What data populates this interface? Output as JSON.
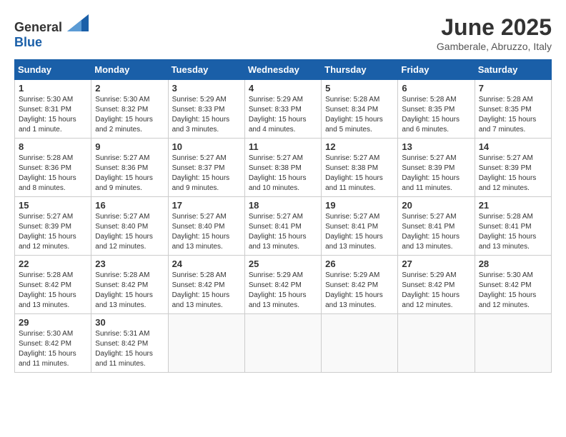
{
  "header": {
    "logo_general": "General",
    "logo_blue": "Blue",
    "title": "June 2025",
    "subtitle": "Gamberale, Abruzzo, Italy"
  },
  "columns": [
    "Sunday",
    "Monday",
    "Tuesday",
    "Wednesday",
    "Thursday",
    "Friday",
    "Saturday"
  ],
  "weeks": [
    [
      {
        "day": "1",
        "info": "Sunrise: 5:30 AM\nSunset: 8:31 PM\nDaylight: 15 hours\nand 1 minute."
      },
      {
        "day": "2",
        "info": "Sunrise: 5:30 AM\nSunset: 8:32 PM\nDaylight: 15 hours\nand 2 minutes."
      },
      {
        "day": "3",
        "info": "Sunrise: 5:29 AM\nSunset: 8:33 PM\nDaylight: 15 hours\nand 3 minutes."
      },
      {
        "day": "4",
        "info": "Sunrise: 5:29 AM\nSunset: 8:33 PM\nDaylight: 15 hours\nand 4 minutes."
      },
      {
        "day": "5",
        "info": "Sunrise: 5:28 AM\nSunset: 8:34 PM\nDaylight: 15 hours\nand 5 minutes."
      },
      {
        "day": "6",
        "info": "Sunrise: 5:28 AM\nSunset: 8:35 PM\nDaylight: 15 hours\nand 6 minutes."
      },
      {
        "day": "7",
        "info": "Sunrise: 5:28 AM\nSunset: 8:35 PM\nDaylight: 15 hours\nand 7 minutes."
      }
    ],
    [
      {
        "day": "8",
        "info": "Sunrise: 5:28 AM\nSunset: 8:36 PM\nDaylight: 15 hours\nand 8 minutes."
      },
      {
        "day": "9",
        "info": "Sunrise: 5:27 AM\nSunset: 8:36 PM\nDaylight: 15 hours\nand 9 minutes."
      },
      {
        "day": "10",
        "info": "Sunrise: 5:27 AM\nSunset: 8:37 PM\nDaylight: 15 hours\nand 9 minutes."
      },
      {
        "day": "11",
        "info": "Sunrise: 5:27 AM\nSunset: 8:38 PM\nDaylight: 15 hours\nand 10 minutes."
      },
      {
        "day": "12",
        "info": "Sunrise: 5:27 AM\nSunset: 8:38 PM\nDaylight: 15 hours\nand 11 minutes."
      },
      {
        "day": "13",
        "info": "Sunrise: 5:27 AM\nSunset: 8:39 PM\nDaylight: 15 hours\nand 11 minutes."
      },
      {
        "day": "14",
        "info": "Sunrise: 5:27 AM\nSunset: 8:39 PM\nDaylight: 15 hours\nand 12 minutes."
      }
    ],
    [
      {
        "day": "15",
        "info": "Sunrise: 5:27 AM\nSunset: 8:39 PM\nDaylight: 15 hours\nand 12 minutes."
      },
      {
        "day": "16",
        "info": "Sunrise: 5:27 AM\nSunset: 8:40 PM\nDaylight: 15 hours\nand 12 minutes."
      },
      {
        "day": "17",
        "info": "Sunrise: 5:27 AM\nSunset: 8:40 PM\nDaylight: 15 hours\nand 13 minutes."
      },
      {
        "day": "18",
        "info": "Sunrise: 5:27 AM\nSunset: 8:41 PM\nDaylight: 15 hours\nand 13 minutes."
      },
      {
        "day": "19",
        "info": "Sunrise: 5:27 AM\nSunset: 8:41 PM\nDaylight: 15 hours\nand 13 minutes."
      },
      {
        "day": "20",
        "info": "Sunrise: 5:27 AM\nSunset: 8:41 PM\nDaylight: 15 hours\nand 13 minutes."
      },
      {
        "day": "21",
        "info": "Sunrise: 5:28 AM\nSunset: 8:41 PM\nDaylight: 15 hours\nand 13 minutes."
      }
    ],
    [
      {
        "day": "22",
        "info": "Sunrise: 5:28 AM\nSunset: 8:42 PM\nDaylight: 15 hours\nand 13 minutes."
      },
      {
        "day": "23",
        "info": "Sunrise: 5:28 AM\nSunset: 8:42 PM\nDaylight: 15 hours\nand 13 minutes."
      },
      {
        "day": "24",
        "info": "Sunrise: 5:28 AM\nSunset: 8:42 PM\nDaylight: 15 hours\nand 13 minutes."
      },
      {
        "day": "25",
        "info": "Sunrise: 5:29 AM\nSunset: 8:42 PM\nDaylight: 15 hours\nand 13 minutes."
      },
      {
        "day": "26",
        "info": "Sunrise: 5:29 AM\nSunset: 8:42 PM\nDaylight: 15 hours\nand 13 minutes."
      },
      {
        "day": "27",
        "info": "Sunrise: 5:29 AM\nSunset: 8:42 PM\nDaylight: 15 hours\nand 12 minutes."
      },
      {
        "day": "28",
        "info": "Sunrise: 5:30 AM\nSunset: 8:42 PM\nDaylight: 15 hours\nand 12 minutes."
      }
    ],
    [
      {
        "day": "29",
        "info": "Sunrise: 5:30 AM\nSunset: 8:42 PM\nDaylight: 15 hours\nand 11 minutes."
      },
      {
        "day": "30",
        "info": "Sunrise: 5:31 AM\nSunset: 8:42 PM\nDaylight: 15 hours\nand 11 minutes."
      },
      {
        "day": "",
        "info": ""
      },
      {
        "day": "",
        "info": ""
      },
      {
        "day": "",
        "info": ""
      },
      {
        "day": "",
        "info": ""
      },
      {
        "day": "",
        "info": ""
      }
    ]
  ]
}
